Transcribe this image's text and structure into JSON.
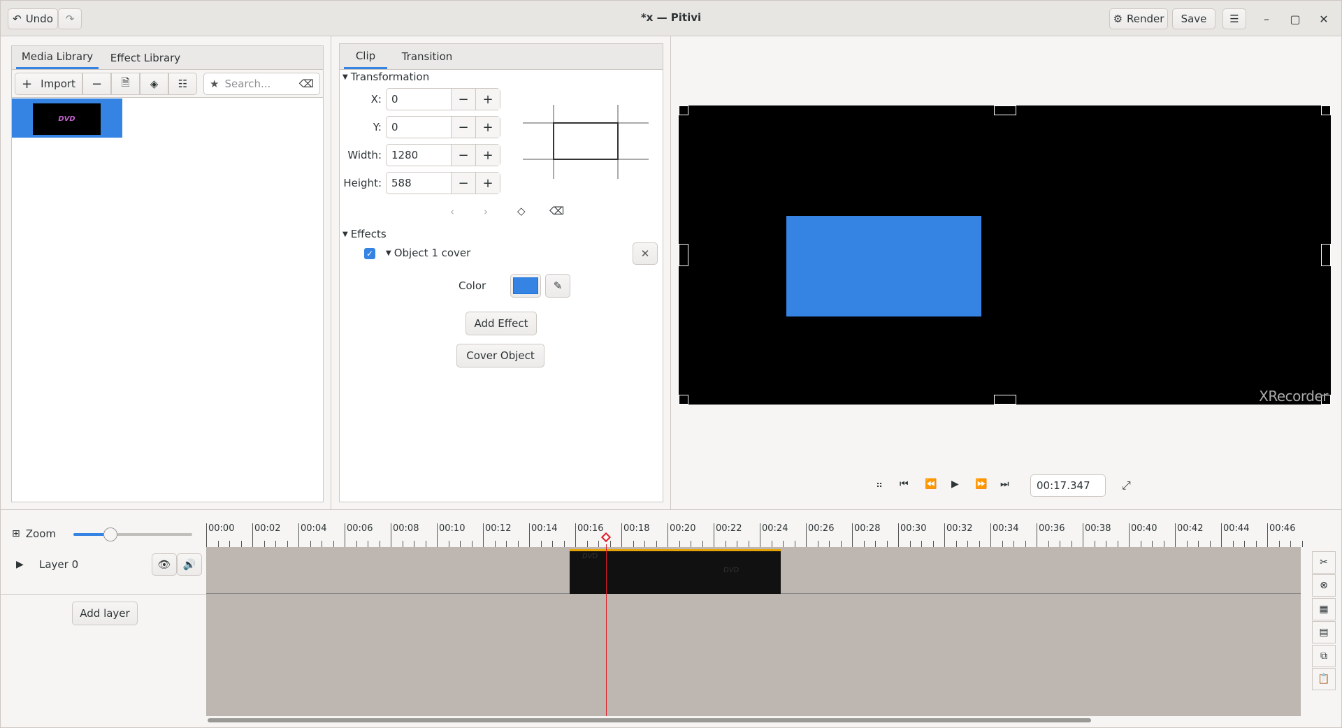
{
  "window": {
    "title": "*x — Pitivi",
    "undo_label": "Undo",
    "redo_icon": "redo-icon",
    "render_label": "Render",
    "save_label": "Save"
  },
  "library": {
    "tabs": [
      "Media Library",
      "Effect Library"
    ],
    "import_label": "Import",
    "search_placeholder": "Search...",
    "thumbnail_text": "DVD"
  },
  "clip_panel": {
    "tabs": [
      "Clip",
      "Transition"
    ],
    "transformation_label": "Transformation",
    "fields": [
      {
        "label": "X:",
        "value": "0"
      },
      {
        "label": "Y:",
        "value": "0"
      },
      {
        "label": "Width:",
        "value": "1280"
      },
      {
        "label": "Height:",
        "value": "588"
      }
    ],
    "effects_label": "Effects",
    "effect_name": "Object 1 cover",
    "effect_enabled": true,
    "color_label": "Color",
    "color_value": "#3584e4",
    "add_effect_label": "Add Effect",
    "cover_object_label": "Cover Object"
  },
  "viewer": {
    "timecode": "00:17.347",
    "watermark": "XRecorder",
    "cover_color": "#3584e4"
  },
  "timeline": {
    "zoom_label": "Zoom",
    "zoom_level": 0.3,
    "ruler_labels": [
      "00:00",
      "00:02",
      "00:04",
      "00:06",
      "00:08",
      "00:10",
      "00:12",
      "00:14",
      "00:16",
      "00:18",
      "00:20",
      "00:22",
      "00:24",
      "00:26",
      "00:28",
      "00:30",
      "00:32",
      "00:34",
      "00:36",
      "00:38",
      "00:40",
      "00:42",
      "00:44",
      "00:46"
    ],
    "layer_name": "Layer 0",
    "add_layer_label": "Add layer",
    "playhead_color": "#e01b24",
    "accent": "#3584e4"
  }
}
